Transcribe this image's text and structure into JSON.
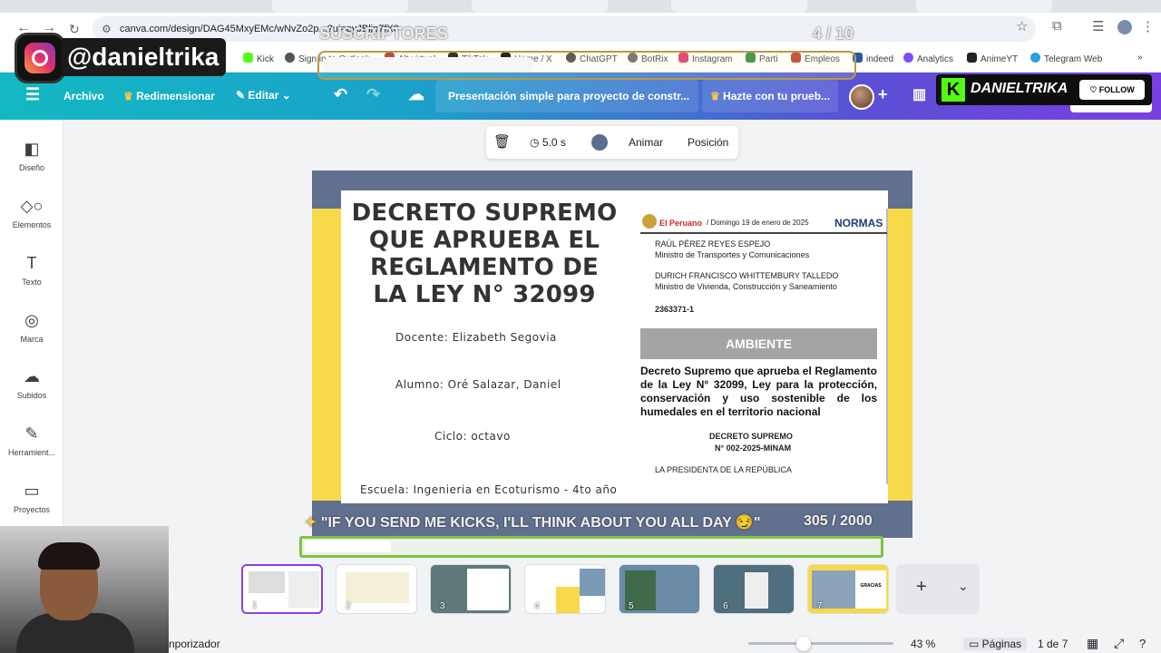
{
  "browser": {
    "url": "canva.com/design/DAG45MxyEMc/wNvZo2p...?ui=eyJBljp7fX0",
    "bookmarks": [
      "Kick",
      "Sign in to Outlook",
      "Alt virtual",
      "TikTok",
      "Home / X",
      "ChatGPT",
      "BotRix",
      "Instagram",
      "Parti",
      "Empleos",
      "indeed",
      "Analytics",
      "AnimeYT",
      "Telegram Web"
    ]
  },
  "header": {
    "menu": "Archivo",
    "resize": "Redimensionar",
    "edit": "Editar",
    "title": "Presentación simple para proyecto de constr...",
    "trial": "Hazte con tu prueb..."
  },
  "sidebar": {
    "items": [
      "Diseño",
      "Elementos",
      "Texto",
      "Marca",
      "Subidos",
      "Herramient...",
      "Proyectos"
    ]
  },
  "floatbar": {
    "duration": "5.0 s",
    "animate": "Animar",
    "position": "Posición"
  },
  "slide": {
    "title": "DECRETO SUPREMO QUE APRUEBA EL REGLAMENTO DE LA LEY N° 32099",
    "teacher": "Docente: Elizabeth Segovia",
    "student": "Alumno: Oré Salazar, Daniel",
    "cycle": "Ciclo: octavo",
    "school": "Escuela: Ingenieria en Ecoturismo - 4to año"
  },
  "newspaper": {
    "brand": "El Peruano",
    "date": "/ Domingo 19 de enero de 2025",
    "section": "NORMAS",
    "name1": "RAÚL PÉREZ REYES ESPEJO",
    "role1": "Ministro de Transportes y Comunicaciones",
    "name2": "DURICH FRANCISCO WHITTEMBURY TALLEDO",
    "role2": "Ministro de Vivienda, Construcción y Saneamiento",
    "code": "2363371-1",
    "ambiente": "AMBIENTE",
    "decree": "Decreto Supremo que aprueba el Reglamento de la Ley N° 32099, Ley para la protección, conservación y uso sostenible de los humedales en el territorio nacional",
    "ds": "DECRETO SUPREMO",
    "ds_num": "N° 002-2025-MINAM",
    "president": "LA PRESIDENTA DE LA REPÚBLICA"
  },
  "overlays": {
    "subs_label": "SUSCRIPTORES",
    "subs_count": "4 / 10",
    "ig_handle": "@danieltrika",
    "kick_name": "DANIELTRIKA",
    "kick_follow": "FOLLOW",
    "kicks_message": "\"IF YOU SEND ME KICKS, I'LL THINK ABOUT YOU ALL DAY 😏\"",
    "kicks_count": "305 / 2000",
    "kicks_progress": 0.15,
    "subs_progress": 0.4
  },
  "thumbnails": [
    "1",
    "2",
    "3",
    "4",
    "5",
    "6",
    "7"
  ],
  "thumb7_label": "GRACIAS",
  "status": {
    "timer": "nporizador",
    "zoom": "43 %",
    "pages": "Páginas",
    "page_of": "1 de 7"
  },
  "colors": {
    "header_start": "#14b8c4",
    "header_end": "#7a3fe0",
    "slide_bg": "#61708f",
    "slide_accent": "#f8d94a",
    "kick_green": "#53fc18"
  }
}
